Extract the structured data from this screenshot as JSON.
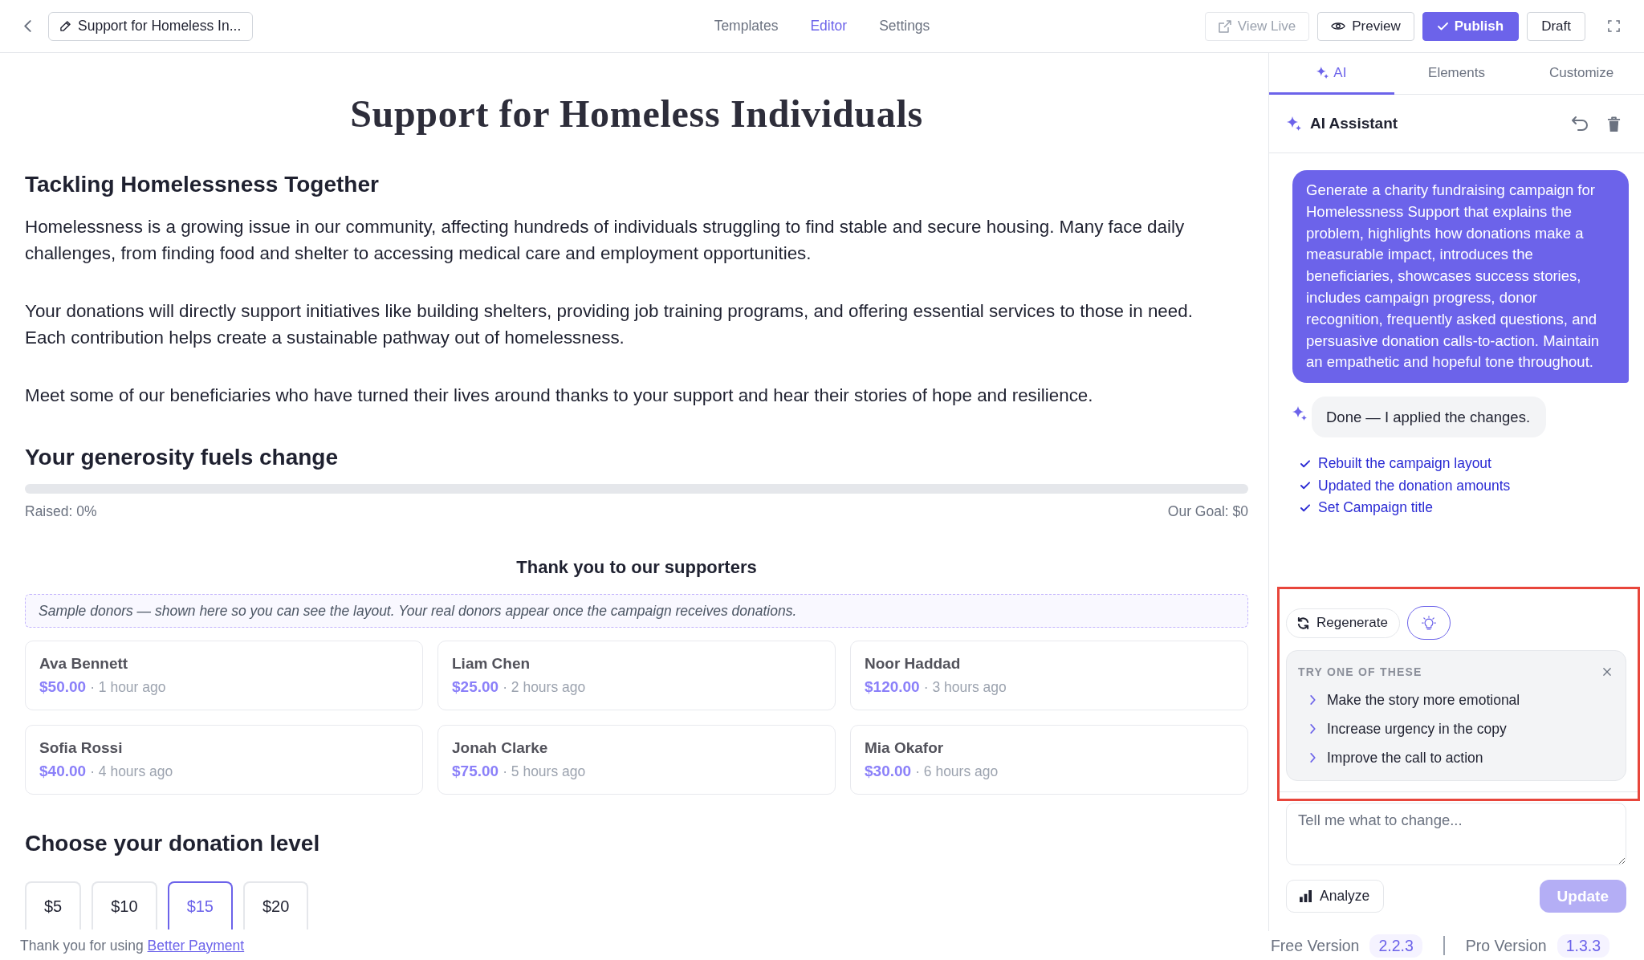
{
  "top_bar": {
    "title_button": "Support for Homeless In...",
    "tabs": [
      {
        "label": "Templates",
        "selected": false
      },
      {
        "label": "Editor",
        "selected": true
      },
      {
        "label": "Settings",
        "selected": false
      }
    ],
    "buttons": [
      {
        "label": "View Live",
        "kind": "view",
        "disabled": true
      },
      {
        "label": "Preview",
        "kind": "preview",
        "disabled": false
      },
      {
        "label": "Publish",
        "kind": "publish",
        "disabled": false
      },
      {
        "label": "Draft",
        "kind": "draft",
        "disabled": false
      }
    ]
  },
  "page": {
    "title": "Support for Homeless Individuals",
    "intro": {
      "heading": "Tackling Homelessness Together",
      "paragraphs": [
        "Homelessness is a growing issue in our community, affecting hundreds of individuals struggling to find stable and secure housing. Many face daily challenges, from finding food and shelter to accessing medical care and employment opportunities.",
        "Your donations will directly support initiatives like building shelters, providing job training programs, and offering essential services to those in need. Each contribution helps create a sustainable pathway out of homelessness.",
        "Meet some of our beneficiaries who have turned their lives around thanks to your support and hear their stories of hope and resilience."
      ]
    },
    "progress": {
      "heading": "Your generosity fuels change",
      "level": 0,
      "raised": "Raised: 0%",
      "goal": "Our Goal: $0"
    },
    "supporters": {
      "heading": "Thank you to our supporters",
      "notice": "Sample donors — shown here so you can see the layout. Your real donors appear once the campaign receives donations.",
      "donors": [
        {
          "name": "Ava Bennett",
          "amount": "$50.00",
          "time": "· 1 hour ago"
        },
        {
          "name": "Liam Chen",
          "amount": "$25.00",
          "time": "· 2 hours ago"
        },
        {
          "name": "Noor Haddad",
          "amount": "$120.00",
          "time": "· 3 hours ago"
        },
        {
          "name": "Sofia Rossi",
          "amount": "$40.00",
          "time": "· 4 hours ago"
        },
        {
          "name": "Jonah Clarke",
          "amount": "$75.00",
          "time": "· 5 hours ago"
        },
        {
          "name": "Mia Okafor",
          "amount": "$30.00",
          "time": "· 6 hours ago"
        }
      ]
    },
    "donation_levels": {
      "heading": "Choose your donation level",
      "options": [
        {
          "label": "$5",
          "selected": false
        },
        {
          "label": "$10",
          "selected": false
        },
        {
          "label": "$15",
          "selected": true
        },
        {
          "label": "$20",
          "selected": false
        }
      ]
    }
  },
  "side_panel": {
    "tabs": [
      {
        "label": "AI",
        "kind": "assistant",
        "selected": true
      },
      {
        "label": "Elements",
        "kind": "plain",
        "selected": false
      },
      {
        "label": "Customize",
        "kind": "plain",
        "selected": false
      }
    ],
    "title": "AI Assistant",
    "messages": [
      {
        "kind": "user",
        "text": "Generate a charity fundraising campaign for Homelessness Support that explains the problem, highlights how donations make a measurable impact, introduces the beneficiaries, showcases success stories, includes campaign progress, donor recognition, frequently asked questions, and persuasive donation calls-to-action. Maintain an empathetic and hopeful tone throughout."
      },
      {
        "kind": "assistant",
        "text": "Done — I applied the changes.",
        "changes": [
          "Rebuilt the campaign layout",
          "Updated the donation amounts",
          "Set Campaign title"
        ]
      }
    ],
    "highlighted": true,
    "regenerate": "Regenerate",
    "ideas_on": true,
    "suggestions": {
      "title": "TRY ONE OF THESE",
      "items": [
        "Make the story more emotional",
        "Increase urgency in the copy",
        "Improve the call to action"
      ]
    },
    "composer": {
      "placeholder": "Tell me what to change...",
      "analyze": "Analyze",
      "update": "Update",
      "update_disabled": true
    }
  },
  "footer": {
    "thanks": "Thank you for using",
    "link": "Better Payment",
    "versions": [
      {
        "label": "Free Version",
        "value": "2.2.3"
      },
      {
        "label": "Pro Version",
        "value": "1.3.3"
      }
    ]
  }
}
